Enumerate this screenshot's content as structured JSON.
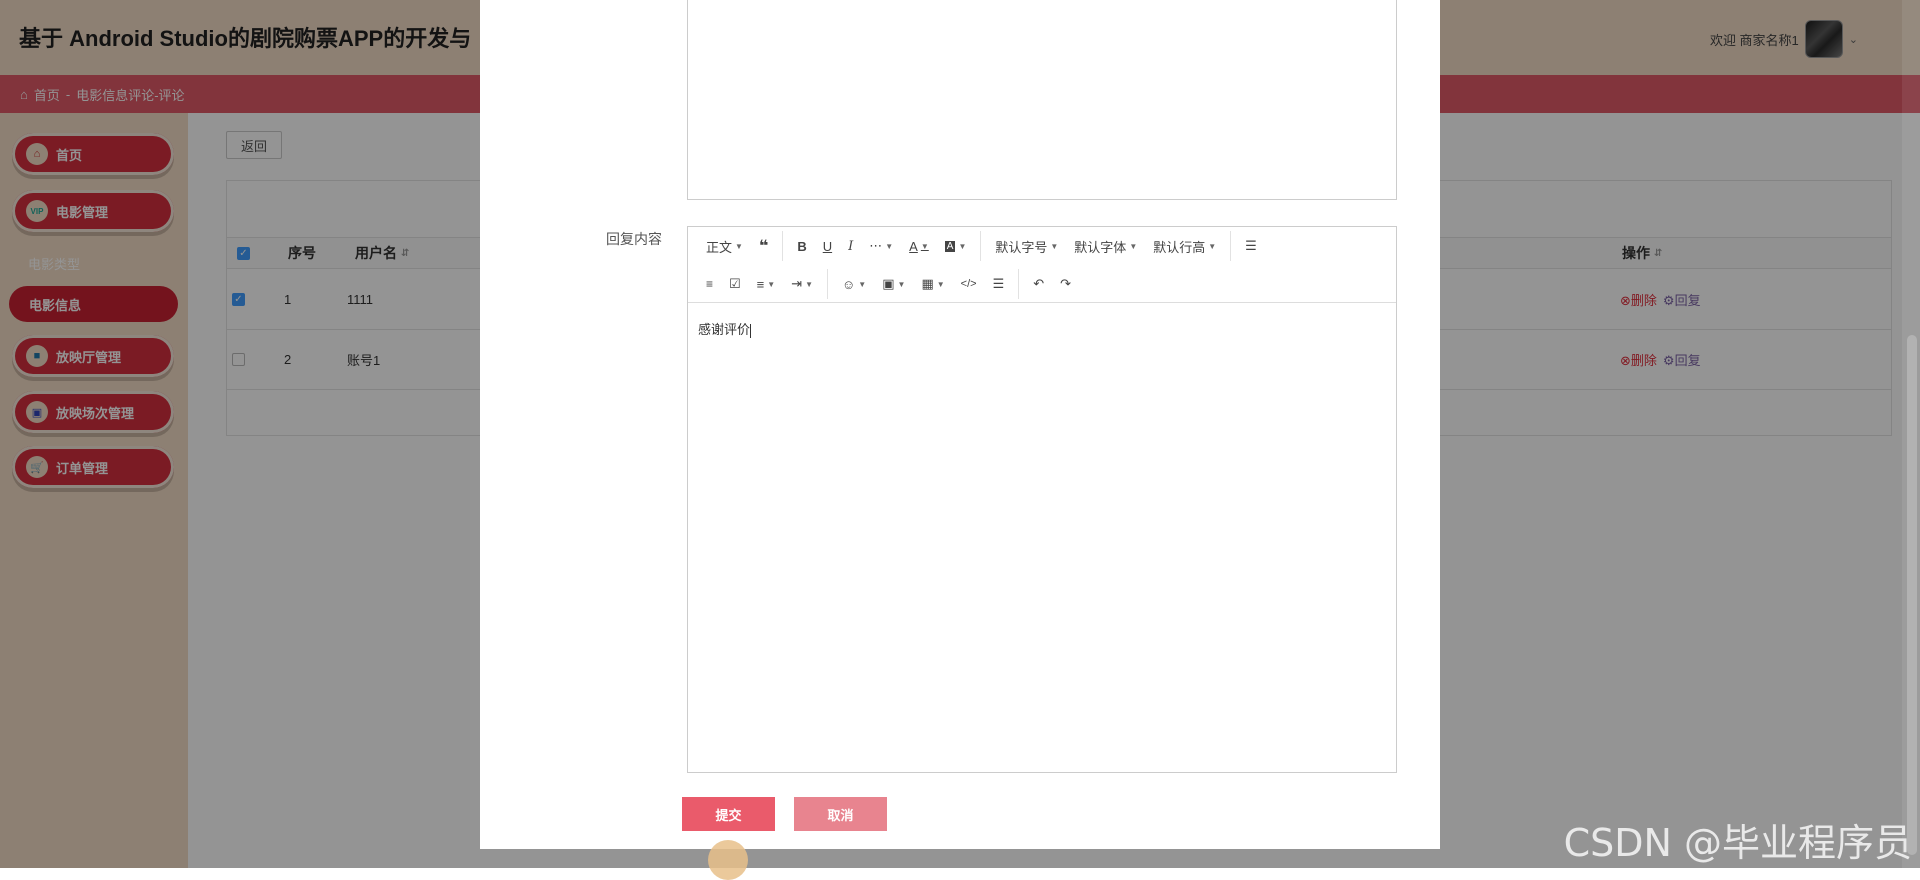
{
  "app": {
    "title": "基于 Android Studio的剧院购票APP的开发与",
    "welcome": "欢迎 商家名称1"
  },
  "breadcrumb": {
    "home": "首页",
    "sep": "-",
    "current": "电影信息评论-评论"
  },
  "sidebar": {
    "items": [
      {
        "label": "首页",
        "icon": "home-icon"
      },
      {
        "label": "电影管理",
        "icon": "vip-icon"
      },
      {
        "label": "放映厅管理",
        "icon": "hall-icon"
      },
      {
        "label": "放映场次管理",
        "icon": "ticket-icon"
      },
      {
        "label": "订单管理",
        "icon": "cart-icon"
      }
    ],
    "sub_items": [
      "电影类型",
      "电影信息"
    ]
  },
  "main": {
    "back_label": "返回",
    "columns": [
      "序号",
      "用户名",
      "操作"
    ],
    "rows": [
      {
        "index": "1",
        "username": "1111",
        "checked": true
      },
      {
        "index": "2",
        "username": "账号1",
        "checked": false
      }
    ],
    "delete_label": "删除",
    "reply_label": "回复"
  },
  "dialog": {
    "reply_label": "回复内容",
    "toolbar": {
      "paragraph": "正文",
      "font_size": "默认字号",
      "font_family": "默认字体",
      "line_height": "默认行高"
    },
    "content": "感谢评价",
    "submit_label": "提交",
    "cancel_label": "取消"
  },
  "watermark": "CSDN @毕业程序员",
  "colors": {
    "brand_red": "#d4303f",
    "breadcrumb_bar": "#e05a68",
    "header_bg": "#f3ddc7",
    "submit": "#ea5b6b",
    "cancel": "#e8848f"
  }
}
